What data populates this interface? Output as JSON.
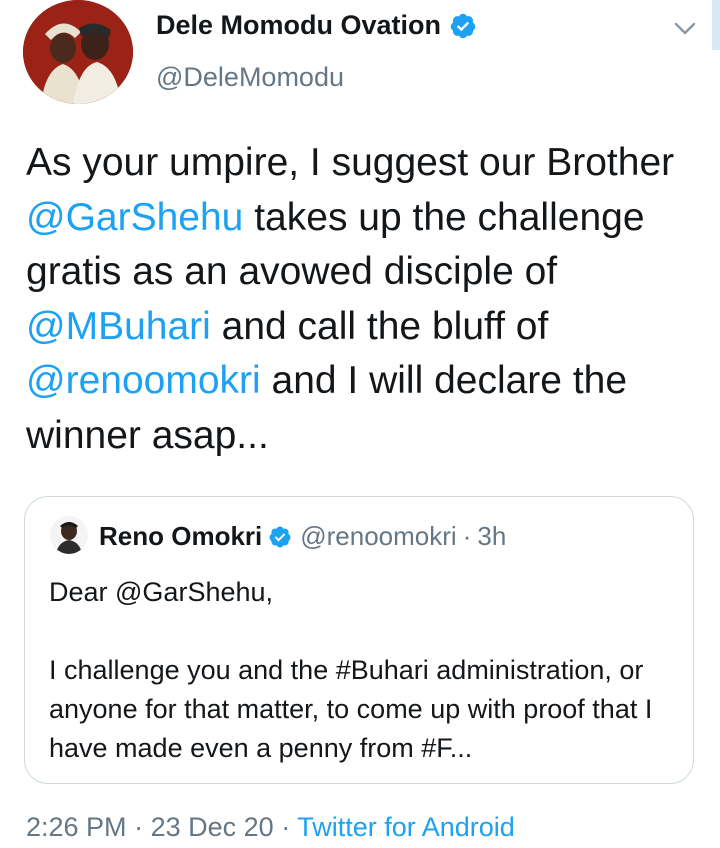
{
  "author": {
    "name": "Dele Momodu Ovation",
    "handle": "@DeleMomodu"
  },
  "tweet": {
    "segments": [
      {
        "text": "As your umpire, I suggest our Brother ",
        "type": "text"
      },
      {
        "text": "@GarShehu",
        "type": "mention"
      },
      {
        "text": " takes up the challenge gratis as an avowed disciple of ",
        "type": "text"
      },
      {
        "text": "@MBuhari",
        "type": "mention"
      },
      {
        "text": " and call the bluff of ",
        "type": "text"
      },
      {
        "text": "@renoomokri",
        "type": "mention"
      },
      {
        "text": " and I will declare the winner asap...",
        "type": "text"
      }
    ]
  },
  "quote": {
    "name": "Reno Omokri",
    "handle": "@renoomokri",
    "separator": "·",
    "time": "3h",
    "greeting": "Dear @GarShehu,",
    "body": "I challenge you and the #Buhari administration, or anyone for that matter, to come up with proof that I have made even a penny from #F..."
  },
  "meta": {
    "time": "2:26 PM",
    "separator": "·",
    "date": "23 Dec 20",
    "separator2": "·",
    "source": "Twitter for Android"
  },
  "icons": {
    "verified": "verified-badge-icon",
    "menu": "chevron-down-icon"
  },
  "colors": {
    "accent": "#1da1f2",
    "text": "#14171a",
    "secondary": "#657786",
    "border": "#cfd9de"
  }
}
